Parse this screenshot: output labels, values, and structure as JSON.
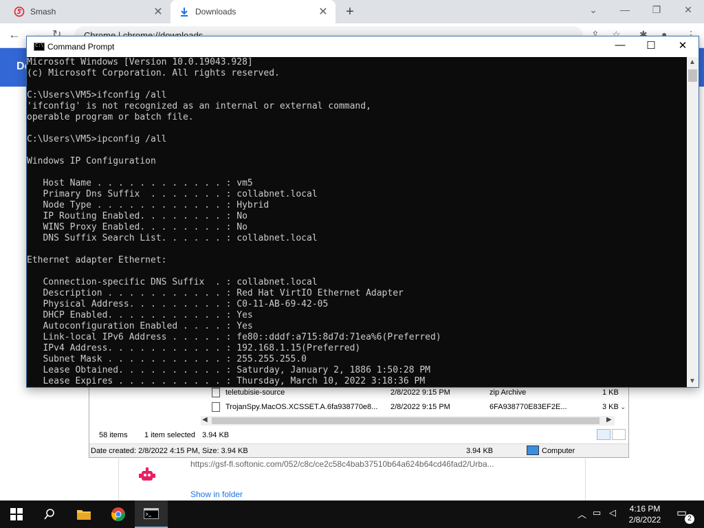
{
  "chrome": {
    "tabs": [
      {
        "label": "Smash"
      },
      {
        "label": "Downloads"
      }
    ],
    "omnibox_text": "Chrome  |  chrome://downloads",
    "page_header_title": "Do"
  },
  "explorer": {
    "rows": [
      {
        "name": "teletubisie-source",
        "date": "2/8/2022 9:15 PM",
        "type": "zip Archive",
        "size": "1 KB"
      },
      {
        "name": "TrojanSpy.MacOS.XCSSET.A.6fa938770e8...",
        "date": "2/8/2022 9:15 PM",
        "type": "6FA938770E83EF2E...",
        "size": "3 KB"
      }
    ],
    "status": {
      "item_count": "58 items",
      "selected": "1 item selected",
      "selected_size": "3.94 KB"
    },
    "details": {
      "info": "Date created: 2/8/2022 4:15 PM, Size: 3.94 KB",
      "size": "3.94 KB",
      "location": "Computer"
    }
  },
  "download_card": {
    "url": "https://gsf-fl.softonic.com/052/c8c/ce2c58c4bab37510b64a624b64cd46fad2/Urba...",
    "show_in_folder": "Show in folder"
  },
  "cmd": {
    "title": "Command Prompt",
    "lines": [
      "Microsoft Windows [Version 10.0.19043.928]",
      "(c) Microsoft Corporation. All rights reserved.",
      "",
      "C:\\Users\\VM5>ifconfig /all",
      "'ifconfig' is not recognized as an internal or external command,",
      "operable program or batch file.",
      "",
      "C:\\Users\\VM5>ipconfig /all",
      "",
      "Windows IP Configuration",
      "",
      "   Host Name . . . . . . . . . . . . : vm5",
      "   Primary Dns Suffix  . . . . . . . : collabnet.local",
      "   Node Type . . . . . . . . . . . . : Hybrid",
      "   IP Routing Enabled. . . . . . . . : No",
      "   WINS Proxy Enabled. . . . . . . . : No",
      "   DNS Suffix Search List. . . . . . : collabnet.local",
      "",
      "Ethernet adapter Ethernet:",
      "",
      "   Connection-specific DNS Suffix  . : collabnet.local",
      "   Description . . . . . . . . . . . : Red Hat VirtIO Ethernet Adapter",
      "   Physical Address. . . . . . . . . : C0-11-AB-69-42-05",
      "   DHCP Enabled. . . . . . . . . . . : Yes",
      "   Autoconfiguration Enabled . . . . : Yes",
      "   Link-local IPv6 Address . . . . . : fe80::dddf:a715:8d7d:71ea%6(Preferred)",
      "   IPv4 Address. . . . . . . . . . . : 192.168.1.15(Preferred)",
      "   Subnet Mask . . . . . . . . . . . : 255.255.255.0",
      "   Lease Obtained. . . . . . . . . . : Saturday, January 2, 1886 1:50:28 PM",
      "   Lease Expires . . . . . . . . . . : Thursday, March 10, 2022 3:18:36 PM"
    ]
  },
  "taskbar": {
    "time": "4:16 PM",
    "date": "2/8/2022",
    "notification_count": "2"
  },
  "colors": {
    "chrome_accent": "#3367d6",
    "console_bg": "#0c0c0c",
    "console_text": "#cccccc",
    "taskbar_bg": "#101010",
    "link_blue": "#1a73e8"
  }
}
